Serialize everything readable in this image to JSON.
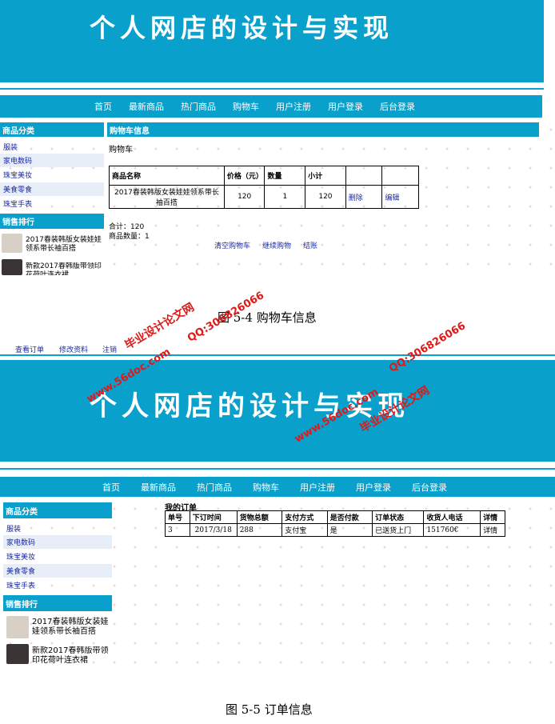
{
  "site_title": "个人网店的设计与实现",
  "nav": [
    "首页",
    "最新商品",
    "热门商品",
    "购物车",
    "用户注册",
    "用户登录",
    "后台登录"
  ],
  "sidebar": {
    "category_heading": "商品分类",
    "categories": [
      "服装",
      "家电数码",
      "珠宝美妆",
      "美食零食",
      "珠宝手表"
    ],
    "rank_heading": "销售排行",
    "rank_items": [
      "2017春装韩版女装娃娃领系带长袖百搭",
      "新款2017春韩版带领印花荷叶连衣裙"
    ]
  },
  "cart": {
    "bar_title": "购物车信息",
    "subtitle": "购物车",
    "headers": [
      "商品名称",
      "价格（元）",
      "数量",
      "小计",
      "",
      ""
    ],
    "rows": [
      [
        "2017春装韩版女装娃娃领系带长袖百搭",
        "120",
        "1",
        "120",
        "删除",
        "编辑"
      ]
    ],
    "total": "合计：120",
    "count": "商品数量：1",
    "actions": [
      "清空购物车",
      "继续购物",
      "结账"
    ]
  },
  "caption1": "图 5-4 购物车信息",
  "user_links": [
    "查看订单",
    "修改资料",
    "注销"
  ],
  "orders": {
    "title": "我的订单",
    "headers": [
      "单号",
      "下订时间",
      "货物总额",
      "支付方式",
      "是否付款",
      "订单状态",
      "收货人电话",
      "详情"
    ],
    "rows": [
      [
        "3",
        "2017/3/18",
        "288",
        "支付宝",
        "是",
        "已送货上门",
        "151760€",
        "详情"
      ]
    ]
  },
  "caption2": "图 5-5 订单信息",
  "watermark": {
    "site": "www.56doc.com",
    "qq": "QQ:306826066",
    "name": "毕业设计论文网"
  },
  "colors": {
    "primary": "#0aa0cc",
    "link": "#1a2aa8",
    "watermark": "#e01818"
  }
}
